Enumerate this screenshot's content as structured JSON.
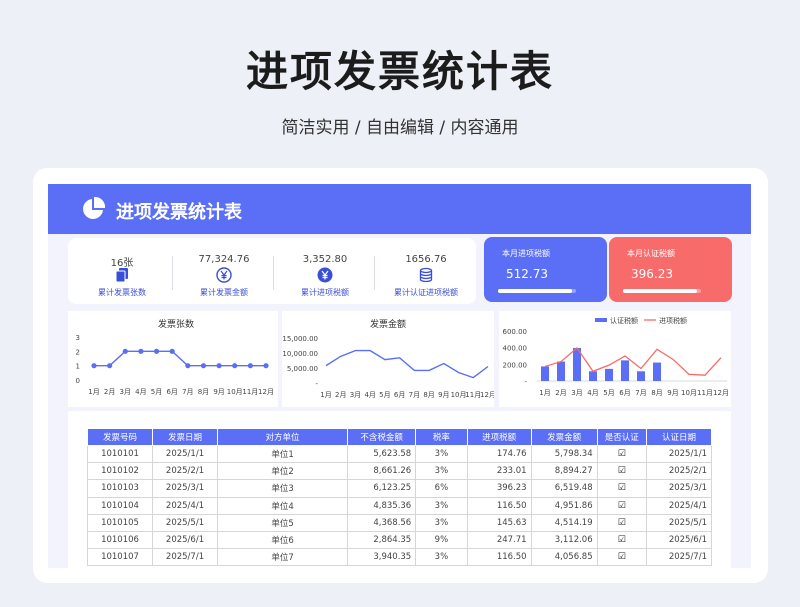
{
  "hero": {
    "title": "进项发票统计表",
    "subtitle": "简洁实用 / 自由编辑 / 内容通用"
  },
  "sheet": {
    "title": "进项发票统计表",
    "title_icon": "pie-chart-icon"
  },
  "stats": [
    {
      "value": "16张",
      "label": "累计发票张数",
      "icon": "invoice-stack-icon"
    },
    {
      "value": "77,324.76",
      "label": "累计发票金额",
      "icon": "yen-coin-icon"
    },
    {
      "value": "3,352.80",
      "label": "累计进项税额",
      "icon": "yen-coin-icon"
    },
    {
      "value": "1656.76",
      "label": "累计认证进项税额",
      "icon": "database-icon"
    }
  ],
  "kpis": {
    "month_input_tax": {
      "label": "本月进项税额",
      "value": "512.73",
      "color": "#5b6ff6",
      "progress": 0.95
    },
    "month_certified_tax": {
      "label": "本月认证税额",
      "value": "396.23",
      "color": "#f76b6b",
      "progress": 0.95
    }
  },
  "colors": {
    "accent": "#5b6ff6",
    "red": "#f76b6b"
  },
  "chart_data": [
    {
      "type": "line",
      "title": "发票张数",
      "categories": [
        "1月",
        "2月",
        "3月",
        "4月",
        "5月",
        "6月",
        "7月",
        "8月",
        "9月",
        "10月",
        "11月",
        "12月"
      ],
      "values": [
        1,
        1,
        2,
        2,
        2,
        2,
        1,
        1,
        1,
        1,
        1,
        1
      ],
      "yticks": [
        "0",
        "1",
        "2",
        "3"
      ],
      "ylim": [
        0,
        3
      ]
    },
    {
      "type": "line",
      "title": "发票金额",
      "categories": [
        "1月",
        "2月",
        "3月",
        "4月",
        "5月",
        "6月",
        "7月",
        "8月",
        "9月",
        "10月",
        "11月",
        "12月"
      ],
      "values": [
        5798.34,
        8894.27,
        10800,
        10800,
        7800,
        8400,
        4200,
        4200,
        6500,
        3500,
        1800,
        5500
      ],
      "yticks": [
        "-",
        "5,000.00",
        "10,000.00",
        "15,000.00"
      ],
      "ylim": [
        0,
        15000
      ]
    },
    {
      "type": "bar",
      "categories": [
        "1月",
        "2月",
        "3月",
        "4月",
        "5月",
        "6月",
        "7月",
        "8月",
        "9月",
        "10月",
        "11月",
        "12月"
      ],
      "yticks": [
        "-",
        "200.00",
        "400.00",
        "600.00"
      ],
      "ylim": [
        0,
        600
      ],
      "legend": [
        "认证税额",
        "进项税额"
      ],
      "series": [
        {
          "name": "认证税额",
          "values": [
            174.76,
            233.01,
            396.23,
            116.5,
            145.63,
            247.71,
            116.5,
            221.4,
            0,
            0,
            0,
            0
          ]
        },
        {
          "name": "进项税额",
          "values": [
            174.76,
            233.01,
            396.23,
            116.5,
            190,
            300,
            150,
            380,
            260,
            80,
            70,
            280
          ]
        }
      ]
    }
  ],
  "table": {
    "headers": [
      "发票号码",
      "发票日期",
      "对方单位",
      "不含税金额",
      "税率",
      "进项税额",
      "发票金额",
      "是否认证",
      "认证日期"
    ],
    "rows": [
      [
        "1010101",
        "2025/1/1",
        "单位1",
        "5,623.58",
        "3%",
        "174.76",
        "5,798.34",
        "☑",
        "2025/1/1"
      ],
      [
        "1010102",
        "2025/2/1",
        "单位2",
        "8,661.26",
        "3%",
        "233.01",
        "8,894.27",
        "☑",
        "2025/2/1"
      ],
      [
        "1010103",
        "2025/3/1",
        "单位3",
        "6,123.25",
        "6%",
        "396.23",
        "6,519.48",
        "☑",
        "2025/3/1"
      ],
      [
        "1010104",
        "2025/4/1",
        "单位4",
        "4,835.36",
        "3%",
        "116.50",
        "4,951.86",
        "☑",
        "2025/4/1"
      ],
      [
        "1010105",
        "2025/5/1",
        "单位5",
        "4,368.56",
        "3%",
        "145.63",
        "4,514.19",
        "☑",
        "2025/5/1"
      ],
      [
        "1010106",
        "2025/6/1",
        "单位6",
        "2,864.35",
        "9%",
        "247.71",
        "3,112.06",
        "☑",
        "2025/6/1"
      ],
      [
        "1010107",
        "2025/7/1",
        "单位7",
        "3,940.35",
        "3%",
        "116.50",
        "4,056.85",
        "☑",
        "2025/7/1"
      ]
    ]
  }
}
